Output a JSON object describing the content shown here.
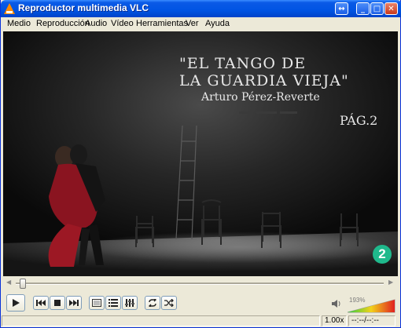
{
  "window": {
    "title": "Reproductor multimedia VLC"
  },
  "menu": [
    "Medio",
    "Reproducción",
    "Audio",
    "Vídeo",
    "Herramientas",
    "Ver",
    "Ayuda"
  ],
  "video": {
    "overlay_line1": "\"EL TANGO DE",
    "overlay_line2": "LA GUARDIA VIEJA\"",
    "overlay_author": "Arturo Pérez-Reverte",
    "overlay_page": "PÁG.2",
    "channel_logo": "2"
  },
  "seek": {
    "position": 0.01
  },
  "controls": {
    "icons": [
      "play-icon",
      "previous-icon",
      "stop-icon",
      "next-icon",
      "fullscreen-icon",
      "playlist-icon",
      "extended-settings-icon",
      "loop-icon",
      "shuffle-icon"
    ]
  },
  "volume": {
    "percent_label": "193%",
    "level": 1.93
  },
  "status": {
    "speed": "1.00x",
    "time": "--:--/--:--"
  },
  "colors": {
    "titlebar": "#0054e3",
    "volume_low": "#2ecc40",
    "volume_high": "#e02020",
    "channel_logo": "#1fb98c"
  }
}
